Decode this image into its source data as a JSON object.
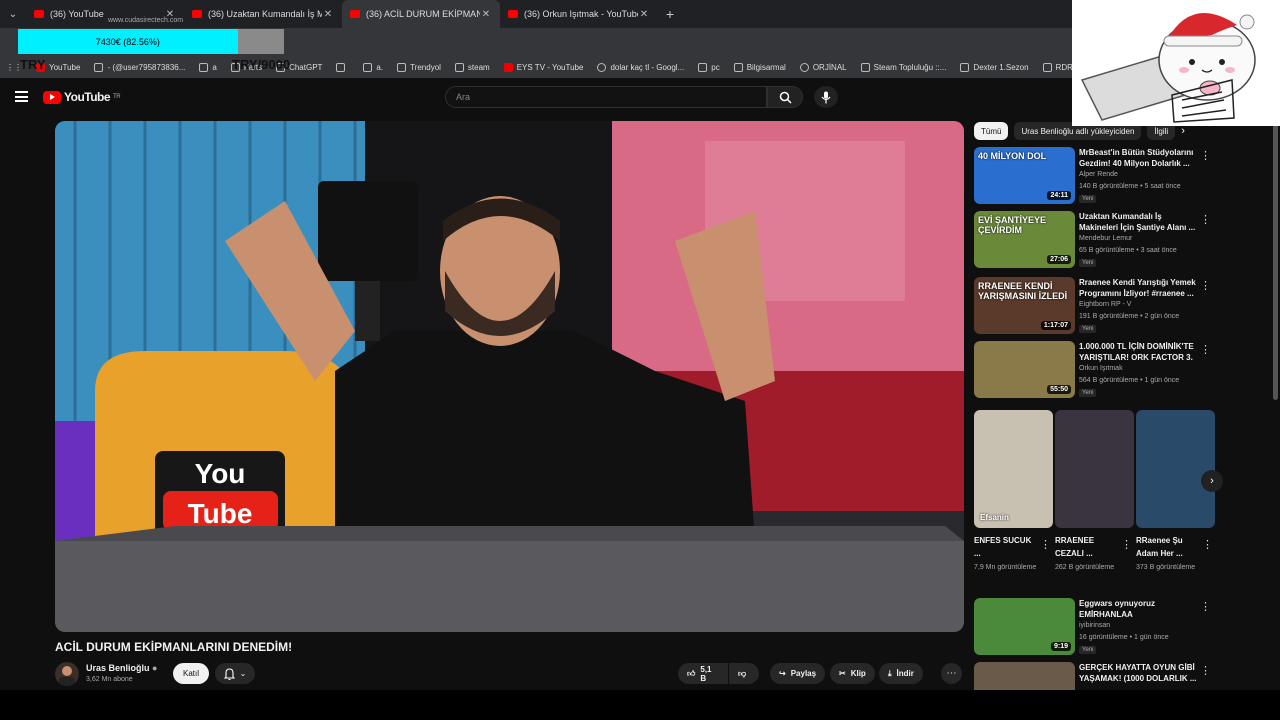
{
  "browser": {
    "tabs": [
      {
        "title": "(36) YouTube"
      },
      {
        "title": "(36) Uzaktan Kumandalı İş Maki"
      },
      {
        "title": "(36) ACİL DURUM EKİPMANLARI"
      },
      {
        "title": "(36) Orkun Işıtmak - YouTube"
      }
    ],
    "tiny_url": "www.cudasirectech.com",
    "extension_progress": {
      "label": "7430€ (82.56%)",
      "fraction": 0.8256
    },
    "overlay_left": "TRY",
    "overlay_goal": "TRY/9000",
    "bookmarks": [
      "YouTube",
      "- (@user795873836...",
      "a",
      "Farts",
      "ChatGPT",
      "",
      "a.",
      "Trendyol",
      "steam",
      "EYS TV - YouTube",
      "dolar kaç tl - Googl...",
      "pc",
      "Bilgisarmal",
      "ORJİNAL",
      "Steam Topluluğu ::...",
      "Dexter 1.Sezon",
      "RDR"
    ]
  },
  "youtube": {
    "logo_text": "YouTube",
    "logo_region": "TR",
    "search_placeholder": "Ara",
    "video": {
      "title": "ACİL DURUM EKİPMANLARINI DENEDİM!",
      "channel": "Uras Benlioğlu",
      "subscribers": "3,62 Mn abone",
      "join_label": "Katıl",
      "likes": "5,1 B",
      "share_label": "Paylaş",
      "clip_label": "Klip",
      "download_label": "İndir",
      "poster_text": {
        "top": "You",
        "bottom": "Tube"
      }
    },
    "chips": [
      "Tümü",
      "Uras Benlioğlu adlı yükleyiciden",
      "İlgili"
    ],
    "recommendations": [
      {
        "title": "MrBeast'in Bütün Stüdyolarını Gezdim! 40 Milyon Dolarlık ...",
        "channel": "Alper Rende",
        "meta": "140 B görüntüleme • 5 saat önce",
        "badge": "Yeni",
        "duration": "24:11",
        "thumb_text": "40 MİLYON DOL",
        "color": "#2a6fd0"
      },
      {
        "title": "Uzaktan Kumandalı İş Makineleri İçin Şantiye Alanı ...",
        "channel": "Mendebur Lemur",
        "meta": "65 B görüntüleme • 3 saat önce",
        "badge": "Yeni",
        "duration": "27:06",
        "thumb_text": "EVİ ŞANTİYEYE ÇEVİRDİM",
        "color": "#6a8a3a"
      },
      {
        "title": "Rraenee Kendi Yarıştığı Yemek Programını İzliyor! #rraenee ...",
        "channel": "Eightborn RP - V",
        "meta": "191 B görüntüleme • 2 gün önce",
        "badge": "Yeni",
        "duration": "1:17:07",
        "thumb_text": "RRAENEE KENDİ YARIŞMASINI İZLEDİ",
        "color": "#5a3a2a"
      },
      {
        "title": "1.000.000 TL İÇİN DOMİNİK'TE YARIŞTILAR! ORK FACTOR 3. ...",
        "channel": "Orkun Işıtmak",
        "meta": "564 B görüntüleme • 1 gün önce",
        "badge": "Yeni",
        "duration": "55:50",
        "thumb_text": "",
        "color": "#8a7a4a"
      },
      {
        "title": "Eggwars oynuyoruz EMİRHANLAA",
        "channel": "iyibirinsan",
        "meta": "16 görüntüleme • 1 gün önce",
        "badge": "Yeni",
        "duration": "9:19",
        "thumb_text": "",
        "color": "#4a8a3a"
      },
      {
        "title": "GERÇEK HAYATTA OYUN GİBİ YAŞAMAK! (1000 DOLARLIK ...",
        "channel": "",
        "meta": "",
        "badge": "",
        "duration": "",
        "thumb_text": "",
        "color": "#6a5a4a"
      }
    ],
    "shorts": [
      {
        "title": "ENFES SUCUK ...",
        "views": "7,9 Mn görüntüleme",
        "thumb_text": "Efsanin",
        "color": "#c8c0b0"
      },
      {
        "title": "RRAENEE CEZALI ...",
        "views": "262 B görüntüleme",
        "thumb_text": "",
        "color": "#3a3440"
      },
      {
        "title": "RRaenee Şu Adam Her ...",
        "views": "373 B görüntüleme",
        "thumb_text": "",
        "color": "#2a4a6a"
      }
    ]
  }
}
